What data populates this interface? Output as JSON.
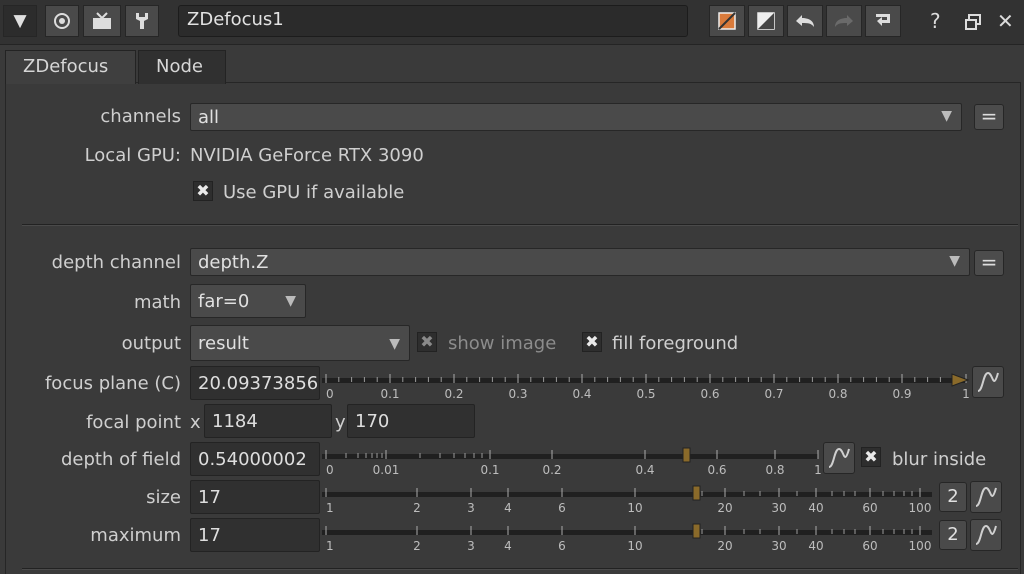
{
  "titlebar": {
    "node_name": "ZDefocus1",
    "icons": [
      "collapse-arrow-icon",
      "center-target-icon",
      "viewer-icon",
      "wrench-icon",
      "color-swatch-icon",
      "white-swatch-icon",
      "undo-icon",
      "redo-icon",
      "revert-icon",
      "help-icon",
      "float-icon",
      "close-icon"
    ],
    "help_label": "?",
    "close_label": "✕"
  },
  "tabs": [
    {
      "label": "ZDefocus",
      "active": true
    },
    {
      "label": "Node",
      "active": false
    }
  ],
  "section1": {
    "channels_label": "channels",
    "channels_value": "all",
    "eq_label": "=",
    "local_gpu_label": "Local GPU:",
    "local_gpu_value": "NVIDIA GeForce RTX 3090",
    "use_gpu_label": "Use GPU if available",
    "use_gpu_checked": true
  },
  "section2": {
    "depth_channel_label": "depth channel",
    "depth_channel_value": "depth.Z",
    "math_label": "math",
    "math_value": "far=0",
    "output_label": "output",
    "output_value": "result",
    "show_image_label": "show image",
    "show_image_checked": true,
    "fill_foreground_label": "fill foreground",
    "fill_foreground_checked": true,
    "focus_plane_label": "focus plane (C)",
    "focus_plane_value": "20.09373856",
    "focus_plane_ticks": [
      "0",
      "0.1",
      "0.2",
      "0.3",
      "0.4",
      "0.5",
      "0.6",
      "0.7",
      "0.8",
      "0.9",
      "1"
    ],
    "focal_point_label": "focal point",
    "focal_x_label": "x",
    "focal_x_value": "1184",
    "focal_y_label": "y",
    "focal_y_value": "170",
    "dof_label": "depth of field",
    "dof_value": "0.54000002",
    "dof_ticks": [
      "0",
      "0.01",
      "0.1",
      "0.2",
      "0.4",
      "0.6",
      "0.8",
      "1"
    ],
    "blur_inside_label": "blur inside",
    "blur_inside_checked": true,
    "size_label": "size",
    "size_value": "17",
    "size_ticks": [
      "1",
      "2",
      "3",
      "4",
      "6",
      "10",
      "20",
      "30",
      "40",
      "60",
      "100"
    ],
    "size_count": "2",
    "maximum_label": "maximum",
    "maximum_value": "17",
    "maximum_ticks": [
      "1",
      "2",
      "3",
      "4",
      "6",
      "10",
      "20",
      "30",
      "40",
      "60",
      "100"
    ],
    "maximum_count": "2"
  },
  "colors": {
    "background": "#3a3a3a",
    "field": "#303030",
    "slider_handle": "#8a6a2a",
    "accent_orange": "#d97a3a"
  }
}
